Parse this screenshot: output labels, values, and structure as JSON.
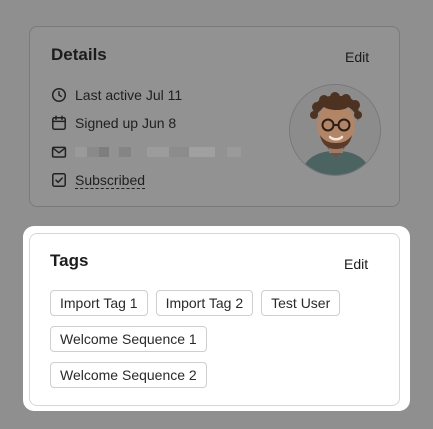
{
  "details": {
    "title": "Details",
    "edit_label": "Edit",
    "last_active": "Last active Jul 11",
    "signed_up": "Signed up Jun 8",
    "subscription": "Subscribed",
    "icons": {
      "last_active": "clock-icon",
      "signed_up": "calendar-icon",
      "email": "mail-icon",
      "subscription": "checkbox-icon"
    },
    "avatar": "avatar-photo"
  },
  "tags": {
    "title": "Tags",
    "edit_label": "Edit",
    "items": [
      "Import Tag 1",
      "Import Tag 2",
      "Test User",
      "Welcome Sequence 1",
      "Welcome Sequence 2"
    ]
  },
  "colors": {
    "overlay": "#8f8f8f",
    "highlight": "#ffffff",
    "tag_border": "#cfcfcf",
    "text": "#1c1c1c"
  }
}
